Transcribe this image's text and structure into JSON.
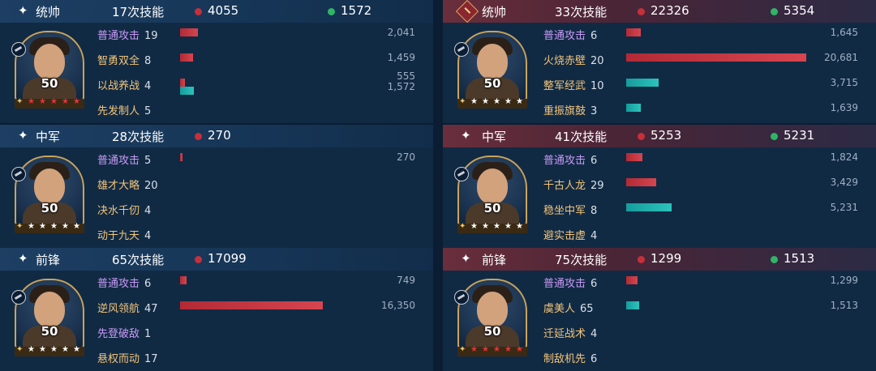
{
  "panels": [
    {
      "side": "left",
      "role": "统帅",
      "count": "17次技能",
      "red_value": "4055",
      "green_value": "1572",
      "level": "50",
      "stars": "red",
      "skills": [
        {
          "name": "普通攻击",
          "n": "19",
          "type": "purple",
          "value": "2,041",
          "red_fraction": 0.125
        },
        {
          "name": "智勇双全",
          "n": "8",
          "type": "gold",
          "value": "1,459",
          "red_fraction": 0.09
        },
        {
          "name": "以战养战",
          "n": "4",
          "type": "gold",
          "value": "555",
          "value2": "1,572",
          "red_fraction": 0.034,
          "teal_fraction": 0.096
        },
        {
          "name": "先发制人",
          "n": "5",
          "type": "gold"
        }
      ]
    },
    {
      "side": "left",
      "role": "中军",
      "count": "28次技能",
      "red_value": "270",
      "level": "50",
      "stars": "white",
      "skills": [
        {
          "name": "普通攻击",
          "n": "5",
          "type": "purple",
          "value": "270",
          "red_fraction": 0.017
        },
        {
          "name": "雄才大略",
          "n": "20",
          "type": "gold"
        },
        {
          "name": "决水千仞",
          "n": "4",
          "type": "gold"
        },
        {
          "name": "动于九天",
          "n": "4",
          "type": "gold"
        }
      ]
    },
    {
      "side": "left",
      "role": "前锋",
      "count": "65次技能",
      "red_value": "17099",
      "level": "50",
      "stars": "white",
      "skills": [
        {
          "name": "普通攻击",
          "n": "6",
          "type": "purple",
          "value": "749",
          "red_fraction": 0.046
        },
        {
          "name": "逆风领航",
          "n": "47",
          "type": "gold",
          "value": "16,350",
          "red_fraction": 1.0
        },
        {
          "name": "先登破敌",
          "n": "1",
          "type": "purple"
        },
        {
          "name": "悬权而动",
          "n": "17",
          "type": "gold"
        }
      ]
    },
    {
      "side": "right",
      "role": "统帅",
      "count": "33次技能",
      "red_value": "22326",
      "green_value": "5354",
      "level": "50",
      "stars": "white",
      "skills": [
        {
          "name": "普通攻击",
          "n": "6",
          "type": "purple",
          "value": "1,645",
          "red_fraction": 0.08
        },
        {
          "name": "火烧赤壁",
          "n": "20",
          "type": "gold",
          "value": "20,681",
          "red_fraction": 1.0
        },
        {
          "name": "整军经武",
          "n": "10",
          "type": "gold",
          "value": "3,715",
          "teal_fraction": 0.18
        },
        {
          "name": "重振旗鼓",
          "n": "3",
          "type": "gold",
          "value": "1,639",
          "teal_fraction": 0.08
        }
      ]
    },
    {
      "side": "right",
      "role": "中军",
      "count": "41次技能",
      "red_value": "5253",
      "green_value": "5231",
      "level": "50",
      "stars": "white",
      "skills": [
        {
          "name": "普通攻击",
          "n": "6",
          "type": "purple",
          "value": "1,824",
          "red_fraction": 0.088
        },
        {
          "name": "千古人龙",
          "n": "29",
          "type": "gold",
          "value": "3,429",
          "red_fraction": 0.166
        },
        {
          "name": "稳坐中军",
          "n": "8",
          "type": "gold",
          "value": "5,231",
          "teal_fraction": 0.253
        },
        {
          "name": "避实击虚",
          "n": "4",
          "type": "gold"
        }
      ]
    },
    {
      "side": "right",
      "role": "前锋",
      "count": "75次技能",
      "red_value": "1299",
      "green_value": "1513",
      "level": "50",
      "stars": "red",
      "skills": [
        {
          "name": "普通攻击",
          "n": "6",
          "type": "purple",
          "value": "1,299",
          "red_fraction": 0.063
        },
        {
          "name": "虞美人",
          "n": "65",
          "type": "gold",
          "value": "1,513",
          "teal_fraction": 0.073
        },
        {
          "name": "迁延战术",
          "n": "4",
          "type": "gold"
        },
        {
          "name": "制敌机先",
          "n": "6",
          "type": "gold"
        }
      ]
    }
  ],
  "colors": {
    "red_bar": "#c5303b",
    "teal_bar": "#1fb3b0",
    "purple_skill": "#c89bf5",
    "gold_skill": "#f2c57a"
  }
}
